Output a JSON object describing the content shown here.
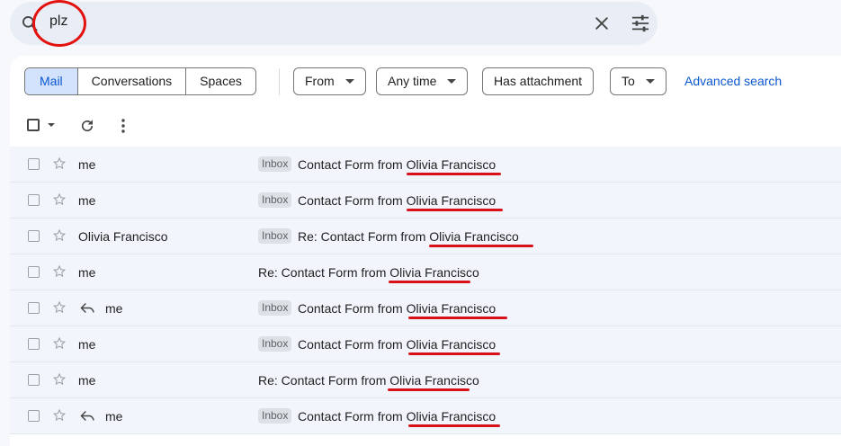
{
  "search": {
    "query": "plz"
  },
  "icons": {
    "search": "search-icon",
    "clear": "close-icon",
    "options": "tune-icon",
    "refresh": "refresh-icon",
    "more": "more-vert-icon",
    "star": "star-icon",
    "reply": "reply-icon"
  },
  "filters": {
    "segments": [
      "Mail",
      "Conversations",
      "Spaces"
    ],
    "active_segment": "Mail",
    "from_label": "From",
    "time_label": "Any time",
    "attachment_label": "Has attachment",
    "to_label": "To",
    "advanced_label": "Advanced search"
  },
  "colors": {
    "accent": "#0b57d0",
    "annotation": "#e3120f",
    "active_chip": "#d3e3fd"
  },
  "emails": [
    {
      "sender": "me",
      "replied": false,
      "label": "Inbox",
      "subject": "Contact Form from Olivia Francisco"
    },
    {
      "sender": "me",
      "replied": false,
      "label": "Inbox",
      "subject": "Contact Form from Olivia Francisco"
    },
    {
      "sender": "Olivia Francisco",
      "replied": false,
      "label": "Inbox",
      "subject": "Re: Contact Form from Olivia Francisco"
    },
    {
      "sender": "me",
      "replied": false,
      "label": "",
      "subject": "Re: Contact Form from Olivia Francisco"
    },
    {
      "sender": "me",
      "replied": true,
      "label": "Inbox",
      "subject": "Contact Form from Olivia Francisco"
    },
    {
      "sender": "me",
      "replied": false,
      "label": "Inbox",
      "subject": "Contact Form from Olivia Francisco"
    },
    {
      "sender": "me",
      "replied": false,
      "label": "",
      "subject": "Re: Contact Form from Olivia Francisco"
    },
    {
      "sender": "me",
      "replied": true,
      "label": "Inbox",
      "subject": "Contact Form from Olivia Francisco"
    }
  ]
}
